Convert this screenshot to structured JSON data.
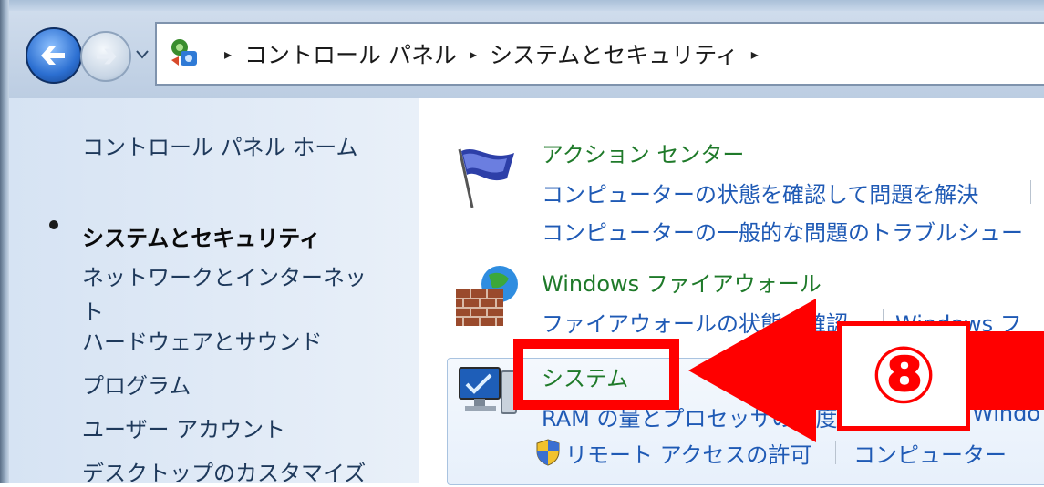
{
  "breadcrumb": {
    "items": [
      "コントロール パネル",
      "システムとセキュリティ"
    ],
    "separator": "▸"
  },
  "sidebar": {
    "items": [
      {
        "label": "コントロール パネル ホーム",
        "active": false
      },
      {
        "label": "システムとセキュリティ",
        "active": true
      },
      {
        "label": "ネットワークとインターネット",
        "active": false
      },
      {
        "label": "ハードウェアとサウンド",
        "active": false
      },
      {
        "label": "プログラム",
        "active": false
      },
      {
        "label": "ユーザー アカウント",
        "active": false
      },
      {
        "label": "デスクトップのカスタマイズ",
        "active": false
      }
    ],
    "network_label_line1": "ネットワークとインターネッ",
    "network_label_line2": "ト"
  },
  "sections": {
    "action_center": {
      "title": "アクション センター",
      "links": [
        "コンピューターの状態を確認して問題を解決",
        "コンピューターの一般的な問題のトラブルシュー"
      ]
    },
    "firewall": {
      "title": "Windows ファイアウォール",
      "links": [
        "ファイアウォールの状態の確認",
        "Windows フ"
      ]
    },
    "system": {
      "title": "システム",
      "links": [
        "RAM の量とプロセッサの速度の表示",
        "Windo"
      ],
      "remote_links": [
        "リモート アクセスの許可",
        "コンピューター"
      ]
    }
  },
  "annotation": {
    "step_label": "⑧",
    "color": "#ff0000"
  },
  "icons": {
    "back": "back-arrow-icon",
    "forward": "forward-arrow-icon",
    "control_panel": "control-panel-icon",
    "action_center": "flag-icon",
    "firewall": "firewall-icon",
    "system": "computer-icon",
    "shield": "uac-shield-icon"
  }
}
